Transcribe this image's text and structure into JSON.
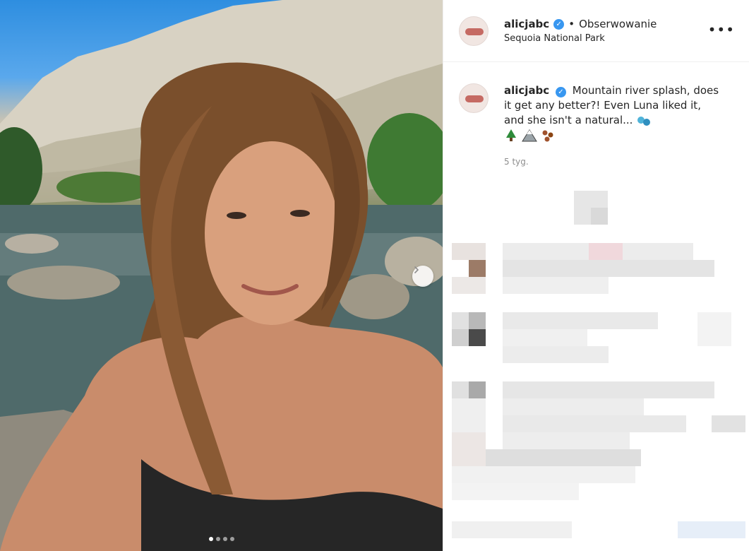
{
  "header": {
    "username": "alicjabc",
    "verified": true,
    "bullet": "•",
    "follow_state": "Obserwowanie",
    "location": "Sequoia National Park"
  },
  "caption": {
    "username": "alicjabc",
    "text": "Mountain river splash, does it get any better?! Even Luna liked it, and she isn't a natural...",
    "time": "5 tyg."
  },
  "carousel": {
    "slides": 4,
    "active": 1
  },
  "icons": {
    "verified": "verified-badge-icon",
    "more": "more-options-icon",
    "next": "chevron-right-icon",
    "emoji_droplets": "droplets-emoji",
    "emoji_tree": "evergreen-tree-emoji",
    "emoji_mountain": "snow-mountain-emoji",
    "emoji_paws": "paw-prints-emoji"
  },
  "colors": {
    "verified": "#3897f0",
    "text": "#262626",
    "secondary": "#8e8e8e"
  }
}
